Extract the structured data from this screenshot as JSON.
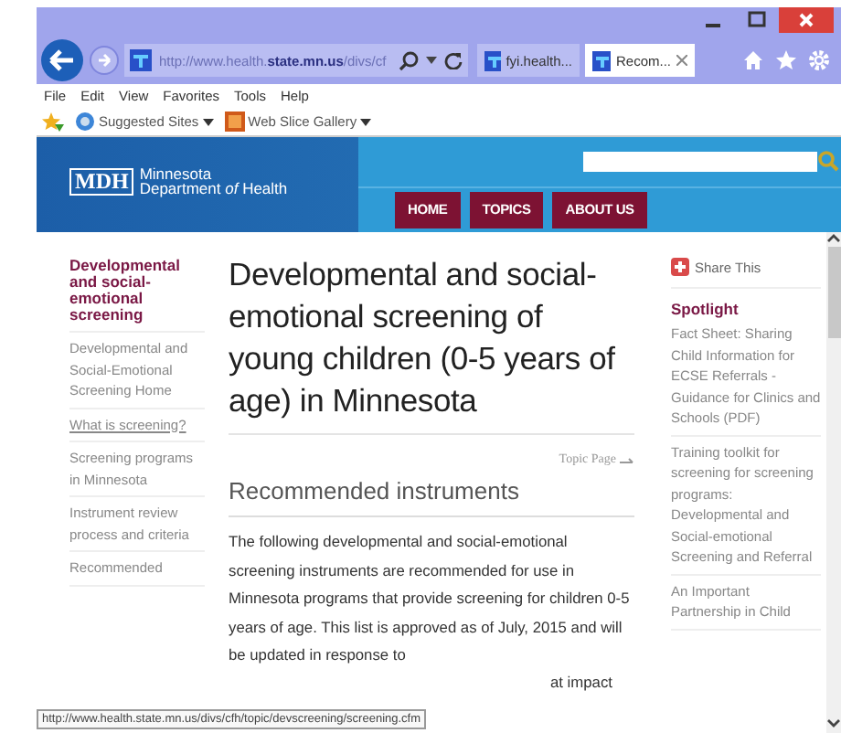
{
  "browser": {
    "url": "http://www.health.**state.mn.us**/divs/cf"
  },
  "tabs": [
    {
      "label": "fyi.health...",
      "selected": false
    },
    {
      "label": "Recom...",
      "selected": true
    }
  ],
  "menu": [
    "File",
    "Edit",
    "View",
    "Favorites",
    "Tools",
    "Help"
  ],
  "favorites": [
    "Suggested Sites",
    "Web Slice Gallery"
  ],
  "site": {
    "logo": "MDH",
    "name_line1": "Minnesota",
    "name_line2": "Department *of* Health",
    "nav": [
      "HOME",
      "TOPICS",
      "ABOUT US"
    ]
  },
  "sidebar": {
    "heading": "Developmental and social-emotional screening",
    "items": [
      {
        "label": "Developmental and Social-Emotional Screening Home",
        "underlined": false
      },
      {
        "label": "What is screening?",
        "underlined": true
      },
      {
        "label": "Screening programs in Minnesota",
        "underlined": false
      },
      {
        "label": "Instrument review process and criteria",
        "underlined": false
      },
      {
        "label": "Recommended",
        "underlined": false
      }
    ]
  },
  "main": {
    "title": "Developmental and social-emotional screening of young children (0-5 years of age) in Minnesota",
    "topic_link": "Topic Page",
    "section_heading": "Recommended instruments",
    "paragraph": "The following developmental and social-emotional screening instruments are recommended for use in Minnesota programs that provide screening for children 0-5 years of age. This list is approved as of July, 2015 and will be updated in response to",
    "paragraph_tail": "at impact"
  },
  "aside": {
    "share": "Share This",
    "heading": "Spotlight",
    "items": [
      "Fact Sheet: Sharing Child Information for ECSE Referrals - Guidance for Clinics and Schools (PDF)",
      "Training toolkit for screening for screening programs: Developmental and Social-emotional Screening and Referral",
      "An Important Partnership in Child"
    ]
  },
  "status_bar": {
    "url": "http://www.health.state.mn.us/divs/cfh/topic/devscreening/screening.cfm"
  }
}
